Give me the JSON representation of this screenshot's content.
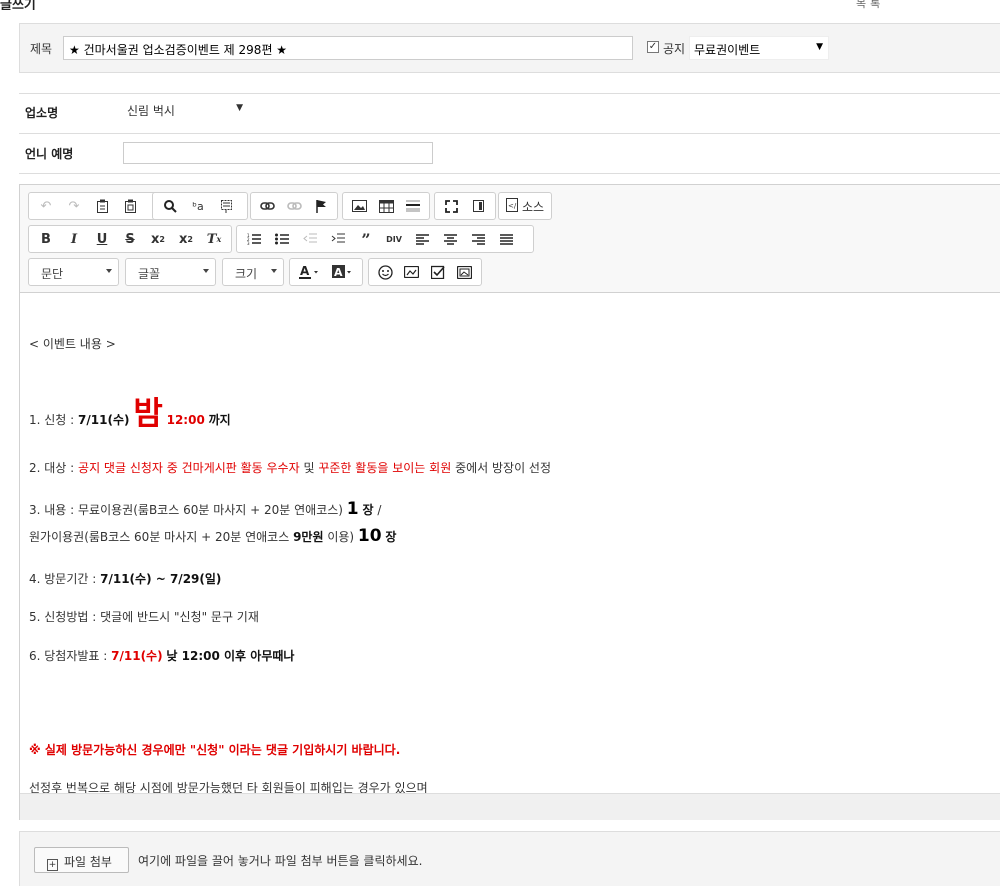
{
  "header": {
    "left_text": "글쓰기",
    "right_text": "목록"
  },
  "title_row": {
    "label": "제목",
    "value": "★ 건마서울권 업소검증이벤트 제 298편 ★",
    "notice_label": "공지",
    "notice_checked": true,
    "category_value": "무료권이벤트"
  },
  "shop_row": {
    "label": "업소명",
    "value": "신림 벅시"
  },
  "nick_row": {
    "label": "언니 예명",
    "value": ""
  },
  "toolbar": {
    "source_label": "소스",
    "format_combo": "문단",
    "font_combo": "글꼴",
    "size_combo": "크기"
  },
  "content": {
    "intro": "< 이벤트 내용 >",
    "l1_a": "1. 신청 : ",
    "l1_b": "7/11(수)",
    "l1_c": "밤",
    "l1_d": "12:00",
    "l1_e": "까지",
    "l2_a": "2. 대상 : ",
    "l2_b": "공지 댓글 신청자 중 건마게시판 활동 우수자",
    "l2_c": "및",
    "l2_d": "꾸준한 활동을 보이는 회원",
    "l2_e": "중에서 방장이 선정",
    "l3_a": "3. 내용 : 무료이용권(룸B코스 60분 마사지 + 20분 연애코스) ",
    "l3_b": "1",
    "l3_c": "장",
    "l3_d": " /",
    "l3_e": "원가이용권(룸B코스 60분 마사지 + 20분 연애코스 ",
    "l3_f": "9만원",
    "l3_g": " 이용) ",
    "l3_h": "10",
    "l3_i": "장",
    "l4_a": "4. 방문기간 : ",
    "l4_b": "7/11(수) ~ 7/29(일)",
    "l5": "5. 신청방법 : 댓글에 반드시 \"신청\" 문구 기재",
    "l6_a": "6. 당첨자발표 : ",
    "l6_b": "7/11(수)",
    "l6_c": "낮 12:00 이후 아무때나",
    "warn": "※ 실제 방문가능하신 경우에만 \"신청\" 이라는 댓글 기입하시기 바랍니다.",
    "tail": "선정후 번복으로 해당 시점에 방문가능했던 타 회원들이 피해입는 경우가 있으며"
  },
  "attach": {
    "button_label": "파일 첨부",
    "hint": "여기에 파일을 끌어 놓거나 파일 첨부 버튼을 클릭하세요."
  }
}
